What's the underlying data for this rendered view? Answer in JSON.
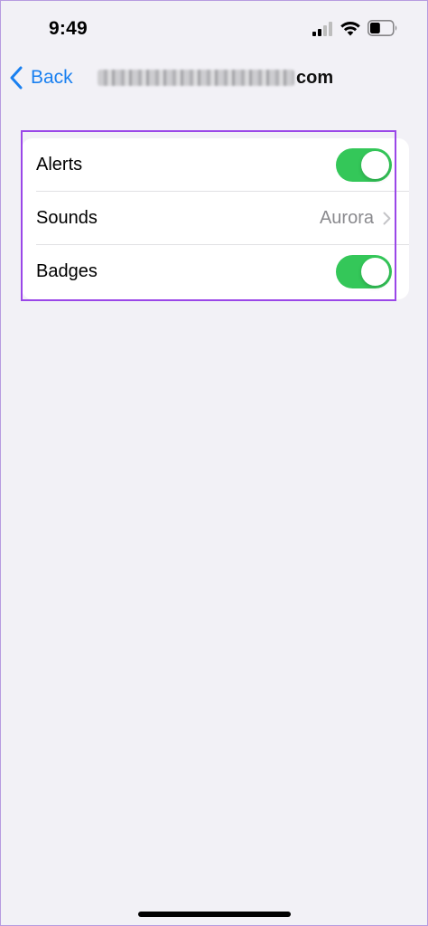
{
  "status_bar": {
    "time": "9:49",
    "icons": [
      "cellular-signal-icon",
      "wifi-icon",
      "battery-icon"
    ],
    "battery_level": 0.45
  },
  "nav": {
    "back_label": "Back",
    "title_suffix": "com"
  },
  "settings": {
    "rows": [
      {
        "label": "Alerts",
        "type": "toggle",
        "on": true
      },
      {
        "label": "Sounds",
        "type": "value",
        "value": "Aurora"
      },
      {
        "label": "Badges",
        "type": "toggle",
        "on": true
      }
    ]
  },
  "colors": {
    "accent": "#1a80f0",
    "toggle_on": "#34c759",
    "highlight": "#9a47e8",
    "background": "#f2f1f6"
  }
}
